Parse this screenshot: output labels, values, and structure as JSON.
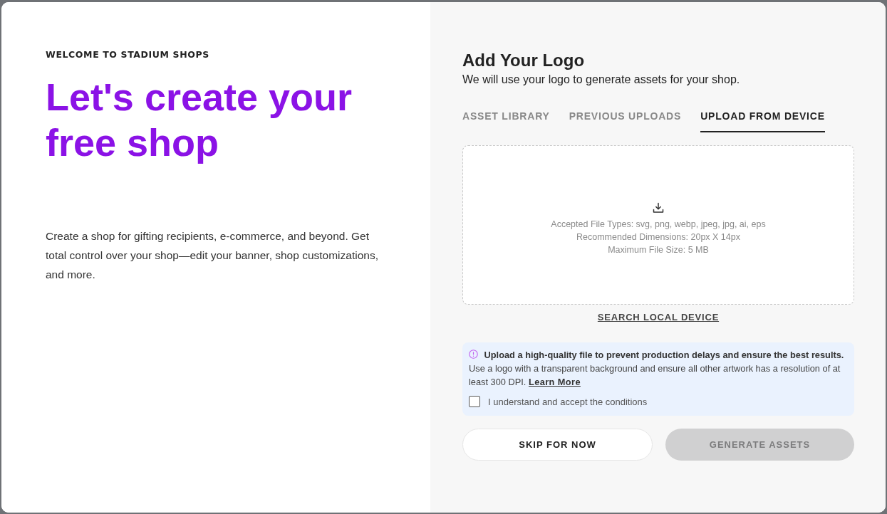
{
  "welcome": {
    "eyebrow": "WELCOME TO STADIUM SHOPS",
    "headline": "Let's create your free shop",
    "description": "Create a shop for gifting recipients, e-commerce, and beyond. Get total control over your shop—edit your banner, shop customizations, and more."
  },
  "logo_panel": {
    "title": "Add Your Logo",
    "subtitle": "We will use your logo to generate assets for your shop.",
    "tabs": [
      {
        "label": "ASSET LIBRARY",
        "selected": false
      },
      {
        "label": "PREVIOUS UPLOADS",
        "selected": false
      },
      {
        "label": "UPLOAD FROM DEVICE",
        "selected": true
      }
    ],
    "dropzone": {
      "lines": [
        "Accepted File Types: svg, png, webp, jpeg, jpg, ai, eps",
        "Recommended Dimensions: 20px X 14px",
        "Maximum File Size: 5 MB"
      ]
    },
    "search_link": "SEARCH LOCAL DEVICE",
    "notice": {
      "text": "**Upload a high-quality file to prevent production delays and ensure the best results.** Use a logo with a transparent background and ensure all other artwork has a resolution of at least 300 DPI.",
      "link": "Learn More"
    },
    "checkbox": {
      "label": "I understand and accept the conditions",
      "checked": false
    },
    "buttons": [
      {
        "label": "SKIP FOR NOW",
        "kind": "secondary",
        "disabled": false
      },
      {
        "label": "GENERATE ASSETS",
        "kind": "primary",
        "disabled": true
      }
    ]
  }
}
